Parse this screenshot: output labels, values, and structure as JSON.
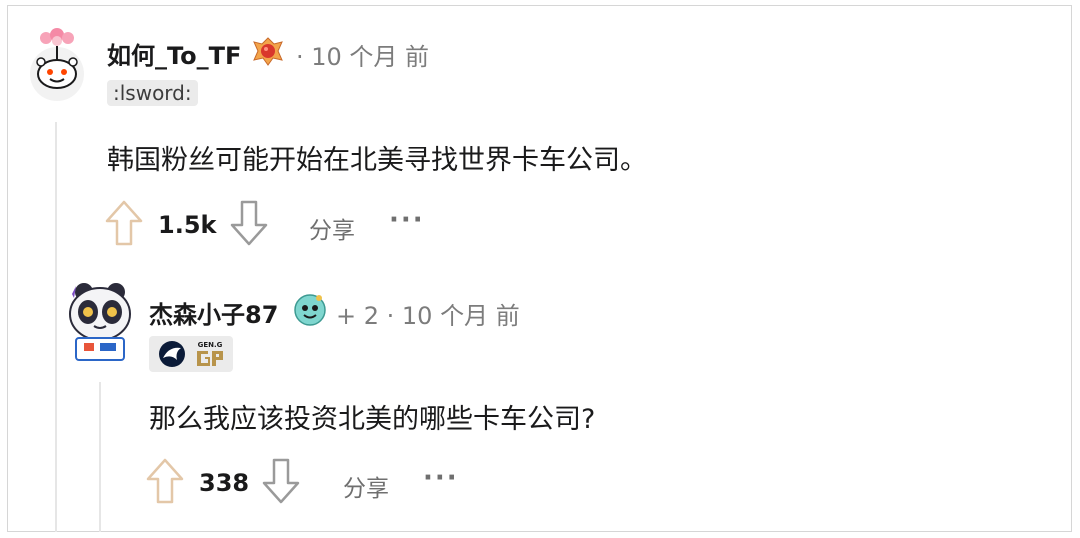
{
  "comments": [
    {
      "author": "如何_To_TF",
      "meta": "· 10 个月 前",
      "flair": ":lsword:",
      "body": "韩国粉丝可能开始在北美寻找世界卡车公司。",
      "votes": "1.5k",
      "share_label": "分享",
      "more_label": "···",
      "avatar_icon": "snoo-avatar-icon",
      "award_icon": "award-icon"
    },
    {
      "author": "杰森小子87",
      "meta": "+ 2 · 10 个月 前",
      "body": "那么我应该投资北美的哪些卡车公司?",
      "votes": "338",
      "share_label": "分享",
      "more_label": "···",
      "avatar_icon": "panda-avatar-icon",
      "award_icon": "award-icon",
      "flair_icons": [
        "team-liquid-icon",
        "gen-g-icon"
      ],
      "flair_icon_text": "GEN.G"
    }
  ],
  "colors": {
    "upvote_arrow": "#e3c7a8",
    "downvote_arrow": "#9a9a9a",
    "meta_text": "#7c7c7c"
  }
}
